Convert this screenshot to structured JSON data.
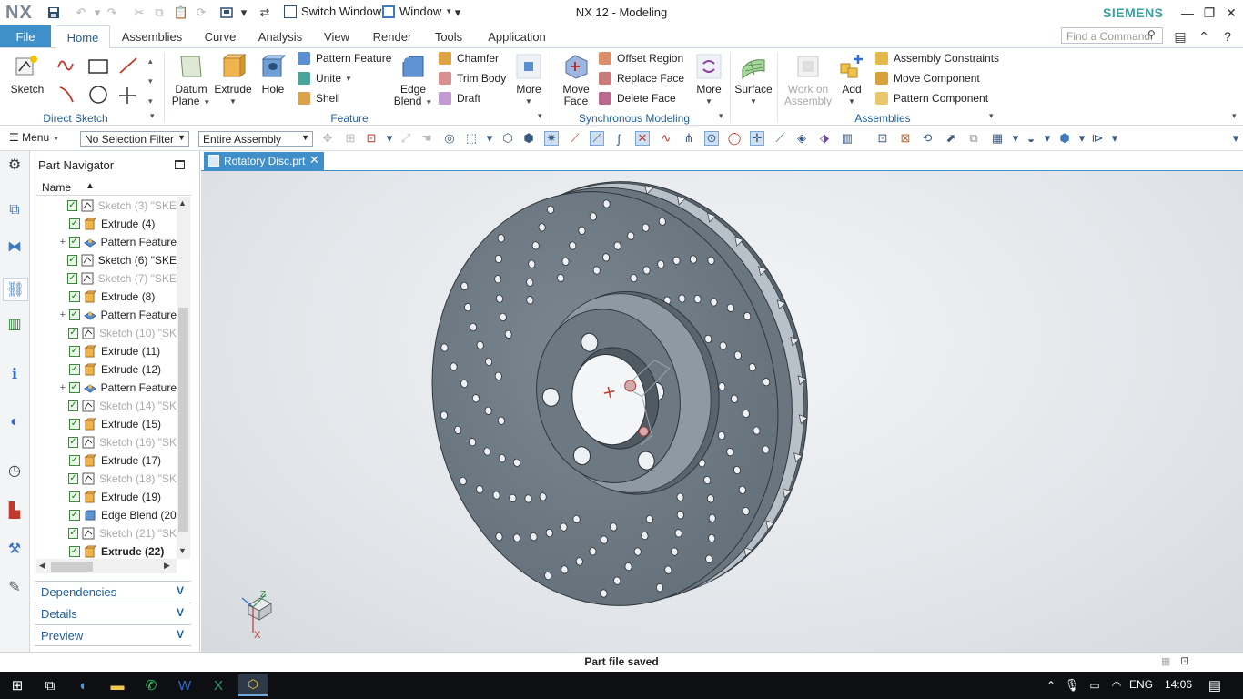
{
  "window": {
    "app_logo": "NX",
    "title": "NX 12 - Modeling",
    "brand": "SIEMENS",
    "switch_window_label": "Switch Window",
    "window_menu_label": "Window"
  },
  "ribbon_tabs": [
    "File",
    "Home",
    "Assemblies",
    "Curve",
    "Analysis",
    "View",
    "Render",
    "Tools",
    "Application"
  ],
  "active_tab": "Home",
  "search": {
    "placeholder": "Find a Command"
  },
  "ribbon": {
    "direct_sketch": {
      "label": "Direct Sketch",
      "sketch": "Sketch"
    },
    "feature": {
      "label": "Feature",
      "datum_plane_1": "Datum",
      "datum_plane_2": "Plane",
      "extrude": "Extrude",
      "hole": "Hole",
      "pattern_feature": "Pattern Feature",
      "unite": "Unite",
      "shell": "Shell",
      "edge_blend_1": "Edge",
      "edge_blend_2": "Blend",
      "chamfer": "Chamfer",
      "trim_body": "Trim Body",
      "draft": "Draft",
      "more": "More"
    },
    "synchronous_modeling": {
      "label": "Synchronous Modeling",
      "move_face_1": "Move",
      "move_face_2": "Face",
      "offset_region": "Offset Region",
      "replace_face": "Replace Face",
      "delete_face": "Delete Face",
      "more": "More"
    },
    "surface": "Surface",
    "assemblies": {
      "label": "Assemblies",
      "work_on_assembly_1": "Work on",
      "work_on_assembly_2": "Assembly",
      "add": "Add",
      "assembly_constraints": "Assembly Constraints",
      "move_component": "Move Component",
      "pattern_component": "Pattern Component"
    }
  },
  "selection_bar": {
    "menu": "Menu",
    "selection_filter": "No Selection Filter",
    "scope": "Entire Assembly"
  },
  "part_navigator": {
    "title": "Part Navigator",
    "column_name": "Name",
    "items": [
      {
        "label": "Sketch (3) \"SKE",
        "type": "sketch",
        "dim": true,
        "expander": ""
      },
      {
        "label": "Extrude (4)",
        "type": "extrude",
        "dim": false,
        "expander": ""
      },
      {
        "label": "Pattern Feature",
        "type": "pattern",
        "dim": false,
        "expander": "+"
      },
      {
        "label": "Sketch (6) \"SKE",
        "type": "sketch",
        "dim": false,
        "expander": ""
      },
      {
        "label": "Sketch (7) \"SKE",
        "type": "sketch",
        "dim": true,
        "expander": ""
      },
      {
        "label": "Extrude (8)",
        "type": "extrude",
        "dim": false,
        "expander": ""
      },
      {
        "label": "Pattern Feature",
        "type": "pattern",
        "dim": false,
        "expander": "+"
      },
      {
        "label": "Sketch (10) \"SK",
        "type": "sketch",
        "dim": true,
        "expander": ""
      },
      {
        "label": "Extrude (11)",
        "type": "extrude",
        "dim": false,
        "expander": ""
      },
      {
        "label": "Extrude (12)",
        "type": "extrude",
        "dim": false,
        "expander": ""
      },
      {
        "label": "Pattern Feature",
        "type": "pattern",
        "dim": false,
        "expander": "+"
      },
      {
        "label": "Sketch (14) \"SK",
        "type": "sketch",
        "dim": true,
        "expander": ""
      },
      {
        "label": "Extrude (15)",
        "type": "extrude",
        "dim": false,
        "expander": ""
      },
      {
        "label": "Sketch (16) \"SK",
        "type": "sketch",
        "dim": true,
        "expander": ""
      },
      {
        "label": "Extrude (17)",
        "type": "extrude",
        "dim": false,
        "expander": ""
      },
      {
        "label": "Sketch (18) \"SK",
        "type": "sketch",
        "dim": true,
        "expander": ""
      },
      {
        "label": "Extrude (19)",
        "type": "extrude",
        "dim": false,
        "expander": ""
      },
      {
        "label": "Edge Blend (20",
        "type": "blend",
        "dim": false,
        "expander": ""
      },
      {
        "label": "Sketch (21) \"SK",
        "type": "sketch",
        "dim": true,
        "expander": ""
      },
      {
        "label": "Extrude (22)",
        "type": "extrude",
        "dim": false,
        "expander": "",
        "bold": true
      }
    ],
    "sections": [
      "Dependencies",
      "Details",
      "Preview"
    ]
  },
  "document_tab": "Rotatory Disc.prt",
  "triad": {
    "z": "Z",
    "x": "X"
  },
  "status": "Part file saved",
  "taskbar": {
    "language": "ENG",
    "time": "14:06"
  },
  "colors": {
    "accent": "#3f8fcb",
    "brand": "#3a9fa5",
    "disc": "#6e7a84",
    "background": "#e3e6ea"
  }
}
